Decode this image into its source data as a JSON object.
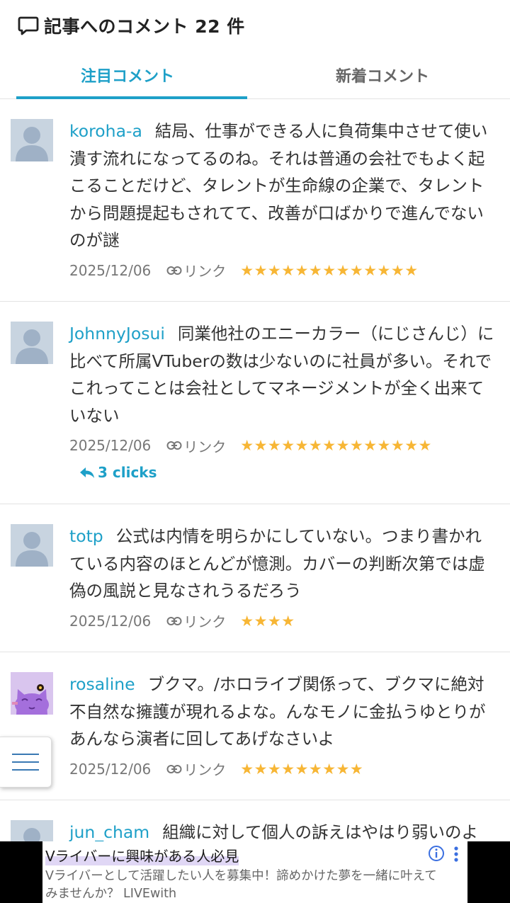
{
  "header": {
    "title": "記事へのコメント 22 件"
  },
  "tabs": [
    {
      "label": "注目コメント",
      "active": true
    },
    {
      "label": "新着コメント",
      "active": false
    }
  ],
  "comments": [
    {
      "user": "koroha-a",
      "text": "結局、仕事ができる人に負荷集中させて使い潰す流れになってるのね。それは普通の会社でもよく起こることだけど、タレントが生命線の企業で、タレントから問題提起もされてて、改善が口ばかりで進んでないのが謎",
      "date": "2025/12/06",
      "link_label": "リンク",
      "stars": "★★★★★★★★★★★★★",
      "avatar": "default"
    },
    {
      "user": "JohnnyJosui",
      "text": "同業他社のエニーカラー（にじさんじ）に比べて所属VTuberの数は少ないのに社員が多い。それでこれってことは会社としてマネージメントが全く出来ていない",
      "date": "2025/12/06",
      "link_label": "リンク",
      "stars": "★★★★★★★★★★★★★★",
      "clicks": "3 clicks",
      "avatar": "default"
    },
    {
      "user": "totp",
      "text": "公式は内情を明らかにしていない。つまり書かれている内容のほとんどが憶測。カバーの判断次第では虚偽の風説と見なされうるだろう",
      "date": "2025/12/06",
      "link_label": "リンク",
      "stars": "★★★★",
      "avatar": "default"
    },
    {
      "user": "rosaline",
      "text": "ブクマ。/ホロライブ関係って、ブクマに絶対不自然な擁護が現れるよな。んなモノに金払うゆとりがあんなら演者に回してあげなさいよ",
      "date": "2025/12/06",
      "link_label": "リンク",
      "stars": "★★★★★★★★★",
      "avatar": "cat"
    },
    {
      "user": "jun_cham",
      "text": "組織に対して個人の訴えはやはり弱いのよ",
      "avatar": "default"
    }
  ],
  "ad": {
    "title": "Vライバーに興味がある人必見",
    "body": "Vライバーとして活躍したい人を募集中！諦めかけた夢を一緒に叶えてみませんか？ LIVEwith"
  },
  "colors": {
    "accent": "#1ea0c8",
    "star": "#f7b635",
    "avatar_bg": "#c8d4e0"
  },
  "icons": {
    "header": "chat-bubble-icon",
    "link": "link-icon",
    "reply": "reply-arrow-icon",
    "menu": "hamburger-menu-icon",
    "ad_info": "info-icon",
    "ad_more": "more-vertical-icon"
  }
}
